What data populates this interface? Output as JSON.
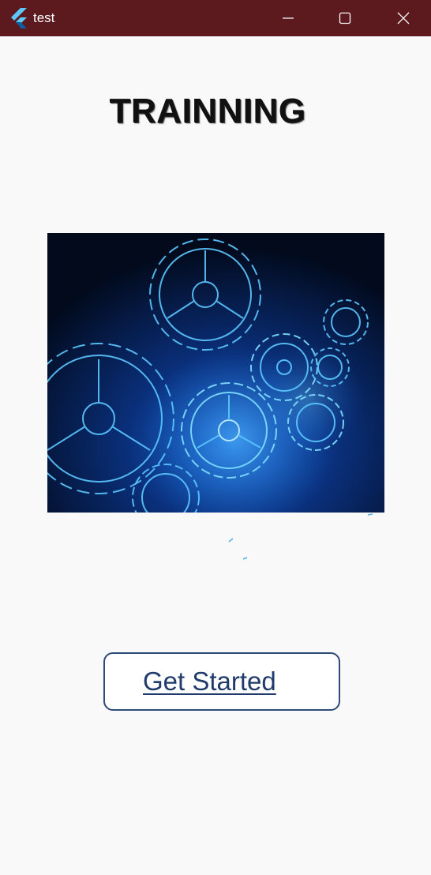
{
  "window": {
    "title": "test",
    "titlebar_color": "#5c1a1f",
    "controls": [
      "minimize-icon",
      "maximize-icon",
      "close-icon"
    ]
  },
  "main": {
    "heading": "TRAINNING",
    "hero_image": {
      "subject": "glowing blue gear wheels on dark background"
    },
    "cta_button": {
      "label": "Get Started",
      "border_color": "#2e4a78",
      "text_color": "#1f3a6b"
    }
  }
}
